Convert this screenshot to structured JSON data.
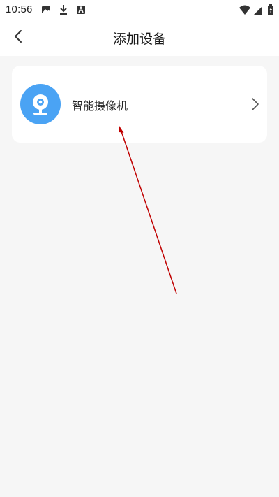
{
  "status_bar": {
    "time": "10:56",
    "left_icons": [
      "image-icon",
      "download-icon",
      "font-icon"
    ],
    "right_icons": [
      "wifi-icon",
      "signal-icon",
      "battery-icon"
    ]
  },
  "header": {
    "title": "添加设备",
    "back_icon": "chevron-left-icon"
  },
  "device_list": [
    {
      "label": "智能摄像机",
      "icon": "camera-icon",
      "icon_color": "#4aa3f4"
    }
  ],
  "colors": {
    "background": "#f6f6f6",
    "card": "#ffffff",
    "accent": "#4aa3f4",
    "annotation_arrow": "#c00000"
  }
}
